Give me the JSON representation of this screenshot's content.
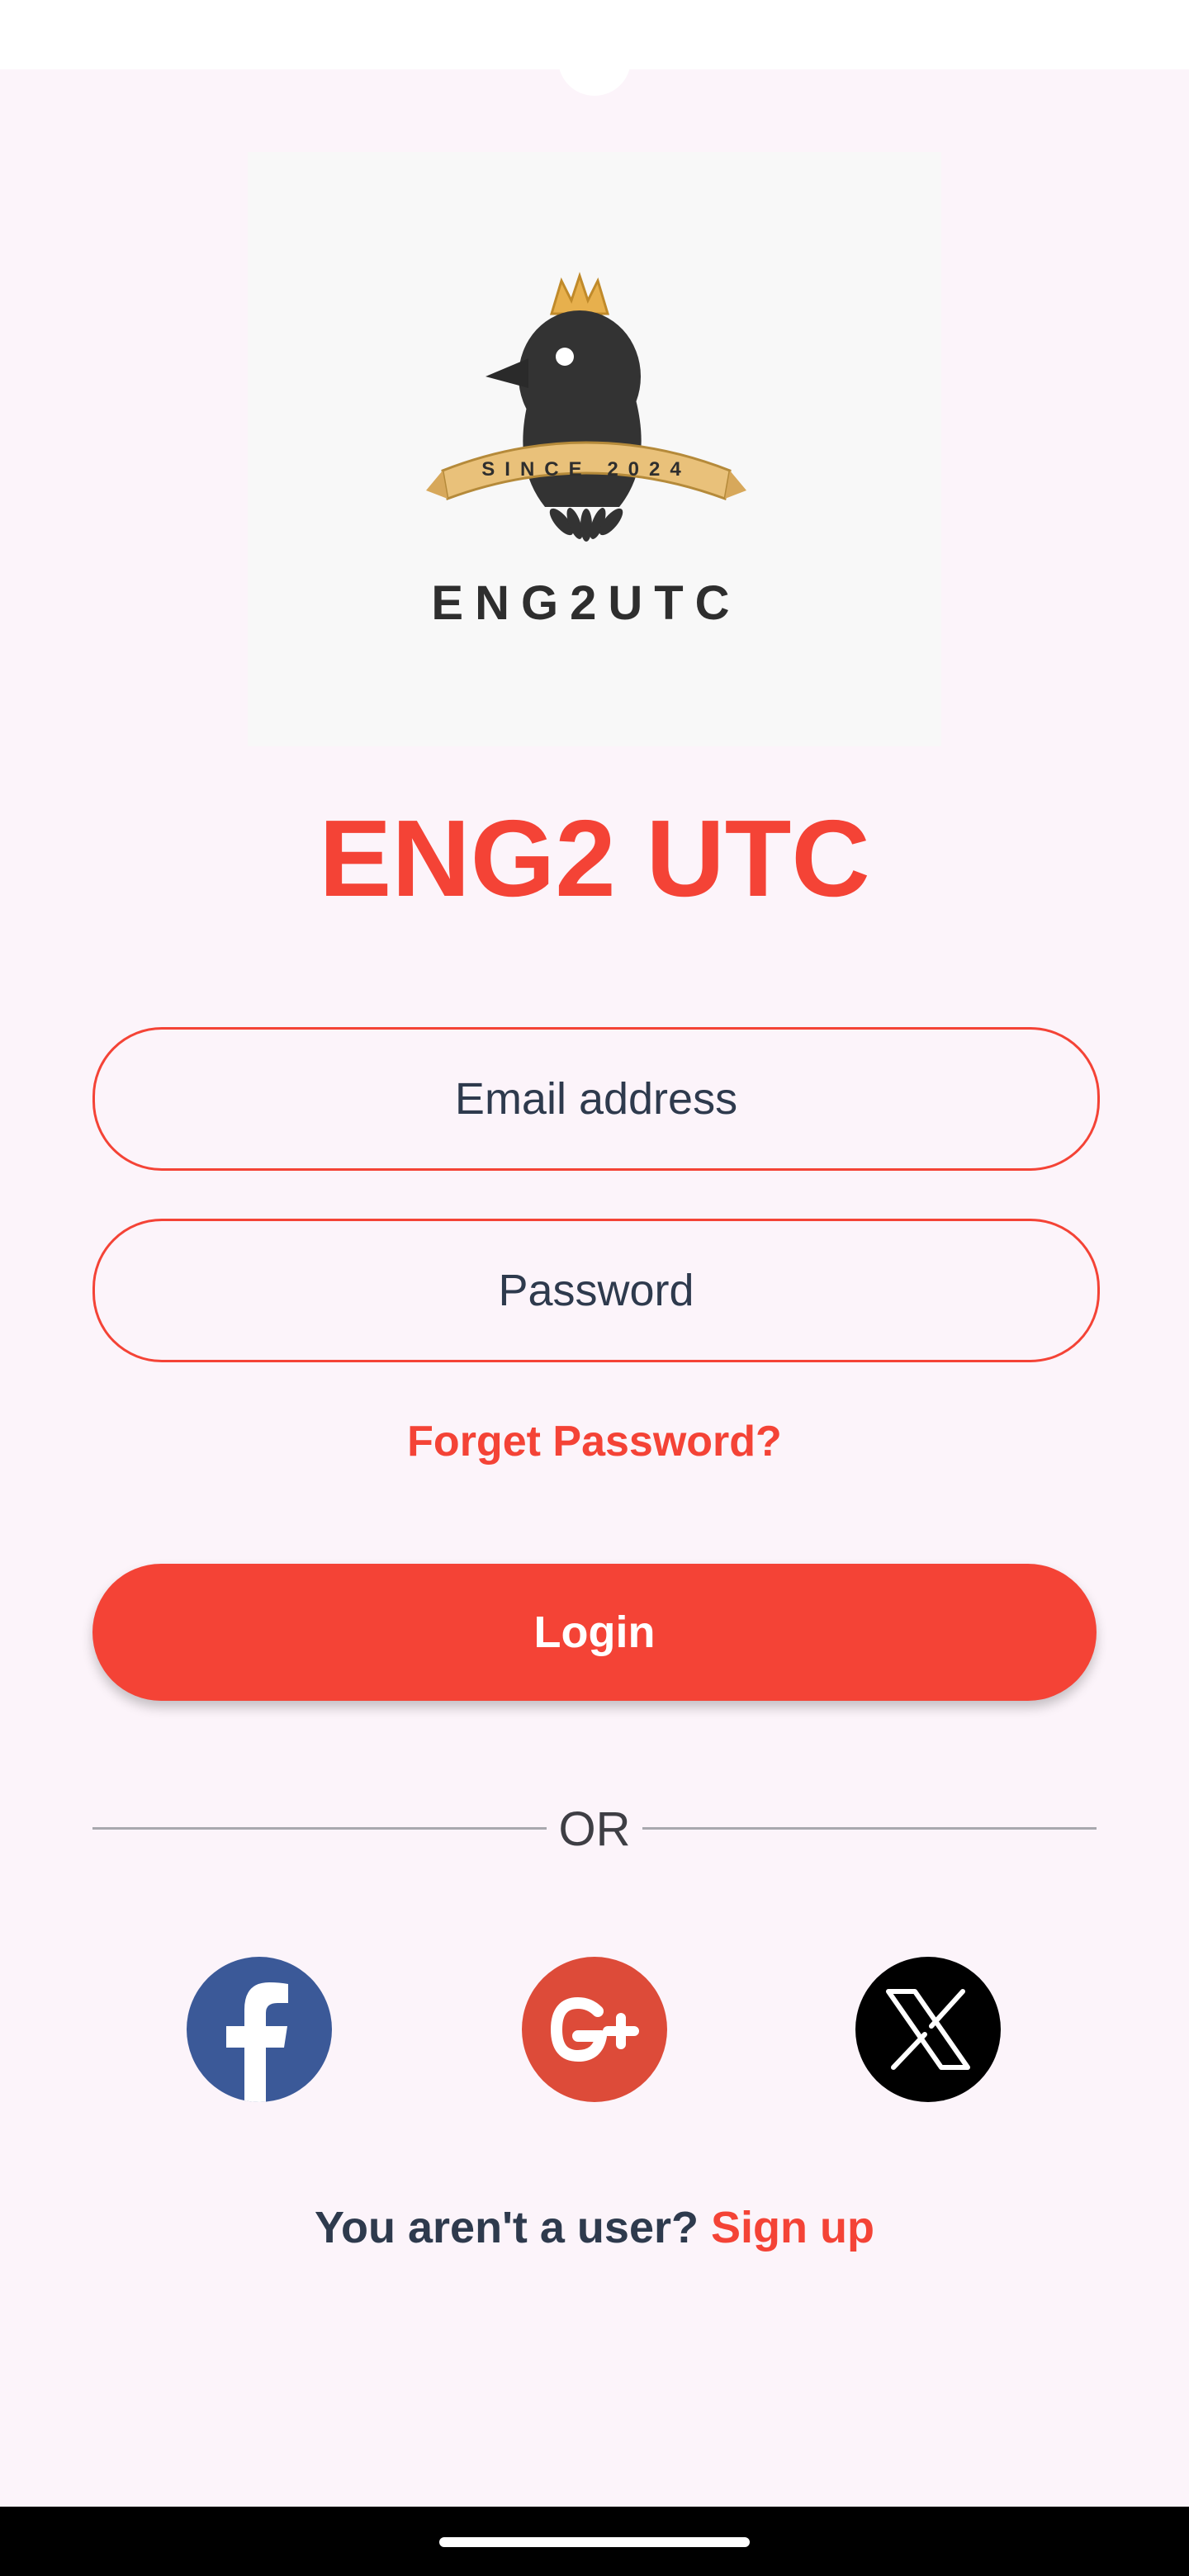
{
  "brand": {
    "logo_ribbon_text": "SINCE 2024",
    "logo_wordmark": "ENG2UTC",
    "app_title": "ENG2 UTC"
  },
  "form": {
    "email_placeholder": "Email address",
    "password_placeholder": "Password",
    "forgot_label": "Forget Password?",
    "login_label": "Login"
  },
  "divider": {
    "label": "OR"
  },
  "social": [
    {
      "name": "facebook",
      "icon": "facebook-icon",
      "color": "#3B5998"
    },
    {
      "name": "google-plus",
      "icon": "google-plus-icon",
      "color": "#DD4B39"
    },
    {
      "name": "x",
      "icon": "x-icon",
      "color": "#000000"
    }
  ],
  "signup": {
    "question": "You aren't a user?",
    "link_label": "Sign up"
  },
  "colors": {
    "accent": "#F44336",
    "background": "#FCF4FA",
    "text_dark": "#2E3A4D"
  }
}
